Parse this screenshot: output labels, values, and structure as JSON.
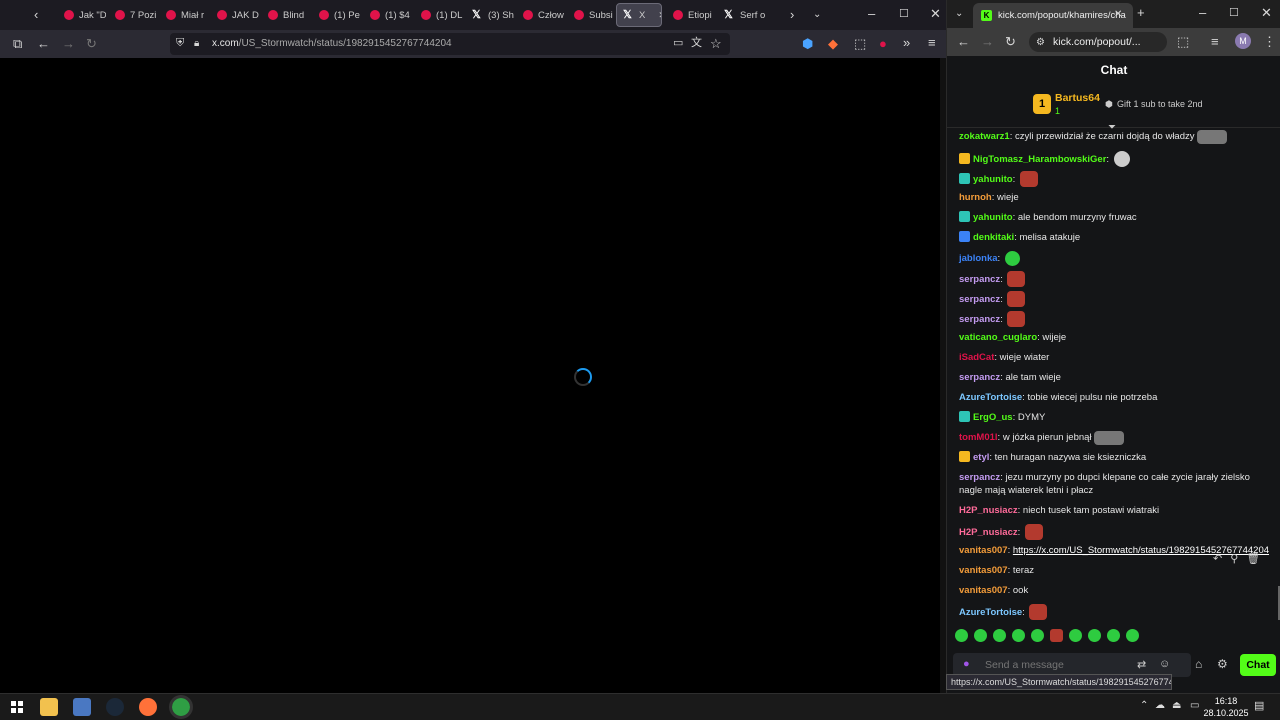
{
  "left_browser": {
    "tabs": [
      {
        "label": "Jak \"D",
        "icon": "youtube-icon"
      },
      {
        "label": "7 Pozi",
        "icon": "youtube-icon"
      },
      {
        "label": "Miał r",
        "icon": "youtube-icon"
      },
      {
        "label": "JAK D",
        "icon": "youtube-icon"
      },
      {
        "label": "Blind",
        "icon": "youtube-icon"
      },
      {
        "label": "(1) Pe",
        "icon": "youtube-icon"
      },
      {
        "label": "(1) $4",
        "icon": "youtube-icon"
      },
      {
        "label": "(1) DL",
        "icon": "youtube-icon"
      },
      {
        "label": "(3) Sh",
        "icon": "x-icon"
      },
      {
        "label": "Człow",
        "icon": "youtube-icon"
      },
      {
        "label": "Subsi",
        "icon": "youtube-icon"
      },
      {
        "label": "X",
        "icon": "x-icon"
      },
      {
        "label": "Etiopi",
        "icon": "youtube-icon"
      },
      {
        "label": "Serf o",
        "icon": "x-icon"
      }
    ],
    "url_domain": "x.com",
    "url_path": "/US_Stormwatch/status/1982915452767744204"
  },
  "right_browser": {
    "tab_title": "kick.com/popout/khamires/cha",
    "url": "kick.com/popout/...",
    "chat_title": "Chat",
    "pinned_user": "Bartus64",
    "pinned_rank": "1",
    "pinned_count": "1",
    "gift_text": "Gift 1 sub to take 2nd",
    "messages": [
      {
        "user": "zokatwarz1",
        "text": "czyli przewidział że czarni dojdą do władzy",
        "color": "#53fc18"
      },
      {
        "user": "NigTomasz_HarambowskiGer",
        "text": "",
        "color": "#53fc18"
      },
      {
        "user": "yahunito",
        "text": "",
        "color": "#53fc18"
      },
      {
        "user": "hurnoh",
        "text": "wieje",
        "color": "#f39c3a"
      },
      {
        "user": "yahunito",
        "text": "ale bendom murzyny fruwac",
        "color": "#53fc18"
      },
      {
        "user": "denkitaki",
        "text": "melisa atakuje",
        "color": "#53fc18"
      },
      {
        "user": "jablonka",
        "text": "",
        "color": "#3b82f6"
      },
      {
        "user": "serpancz",
        "text": "",
        "color": "#c39bf0"
      },
      {
        "user": "serpancz",
        "text": "",
        "color": "#c39bf0"
      },
      {
        "user": "serpancz",
        "text": "",
        "color": "#c39bf0"
      },
      {
        "user": "vaticano_cuglaro",
        "text": "wijeje",
        "color": "#53fc18"
      },
      {
        "user": "iSadCat",
        "text": "wieje wiater",
        "color": "#e0134a"
      },
      {
        "user": "serpancz",
        "text": "ale tam wieje",
        "color": "#c39bf0"
      },
      {
        "user": "AzureTortoise",
        "text": "tobie wiecej pulsu nie potrzeba",
        "color": "#7cc7ff"
      },
      {
        "user": "ErgO_us",
        "text": "DYMY",
        "color": "#53fc18"
      },
      {
        "user": "tomM01l",
        "text": "w józka pierun jebnął",
        "color": "#e0134a"
      },
      {
        "user": "etyl",
        "text": "ten huragan nazywa sie ksiezniczka",
        "color": "#c39bf0"
      },
      {
        "user": "serpancz",
        "text": "jezu murzyny po dupci klepane co całe zycie jarały zielsko nagle mają wiaterek letni i płacz",
        "color": "#c39bf0"
      },
      {
        "user": "H2P_nusiacz",
        "text": "niech tusek tam postawi wiatraki",
        "color": "#ff6b9a"
      },
      {
        "user": "H2P_nusiacz",
        "text": "",
        "color": "#ff6b9a"
      },
      {
        "user": "vanitas007",
        "text": "https://x.com/US_Stormwatch/status/1982915452767744204",
        "color": "#f39c3a"
      },
      {
        "user": "vanitas007",
        "text": "teraz",
        "color": "#f39c3a"
      },
      {
        "user": "vanitas007",
        "text": "ook",
        "color": "#f39c3a"
      },
      {
        "user": "AzureTortoise",
        "text": "",
        "color": "#7cc7ff"
      }
    ],
    "input_placeholder": "Send a message",
    "send_label": "Chat"
  },
  "status_url": "https://x.com/US_Stormwatch/status/1982915452767744204",
  "clock": {
    "time": "16:18",
    "date": "28.10.2025"
  },
  "colors": {
    "kick_green": "#53fc18",
    "x_blue": "#1d9bf0"
  }
}
